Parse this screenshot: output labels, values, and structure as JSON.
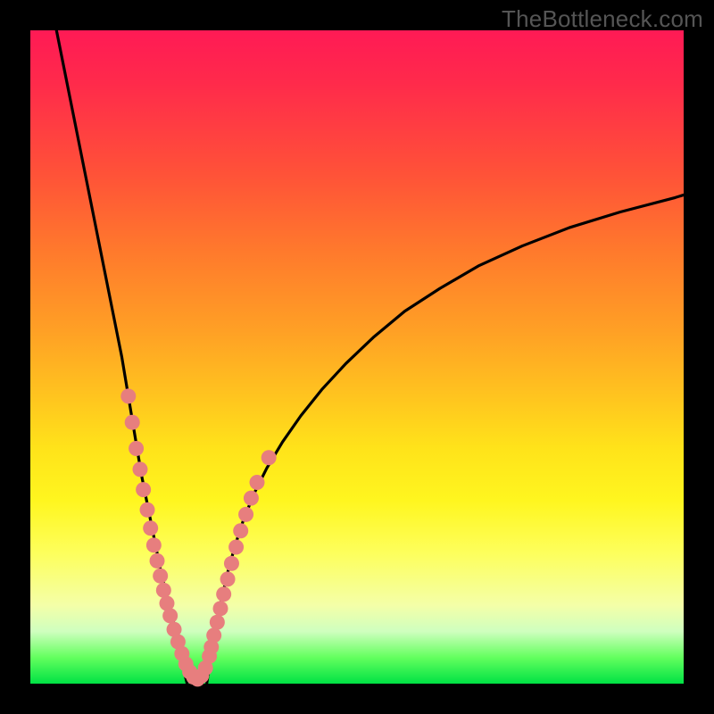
{
  "watermark": "TheBottleneck.com",
  "colors": {
    "background": "#000000",
    "curve": "#000000",
    "dot": "#e77e7e",
    "gradient_top": "#ff1a55",
    "gradient_bottom": "#00e244"
  },
  "chart_data": {
    "type": "line",
    "title": "",
    "xlabel": "",
    "ylabel": "",
    "xlim": [
      0,
      100
    ],
    "ylim": [
      0,
      100
    ],
    "note": "No axis ticks or numeric labels are drawn in the image; x/y units unknown. Values are fractional positions of the curve read off the plot.",
    "series": [
      {
        "name": "left-branch",
        "x": [
          4,
          6,
          8,
          10,
          12,
          14,
          15,
          16,
          17,
          18,
          19,
          20,
          21,
          22,
          22.5,
          23,
          23.5,
          24
        ],
        "y": [
          100,
          90,
          80,
          70,
          60,
          50,
          44,
          38,
          32,
          27,
          22,
          17,
          13,
          9,
          6,
          4,
          2,
          0
        ]
      },
      {
        "name": "right-branch",
        "x": [
          27,
          27.3,
          27.8,
          28.5,
          29.3,
          30.2,
          31.3,
          32.6,
          34.2,
          36.2,
          38.6,
          41.4,
          44.6,
          48.3,
          52.5,
          57.3,
          62.7,
          68.7,
          75.3,
          82.5,
          90.3,
          98.7,
          100
        ],
        "y": [
          0,
          2,
          5,
          9,
          13,
          17,
          21,
          25,
          29,
          33,
          37,
          41,
          45,
          49,
          53,
          57,
          60.5,
          64,
          67,
          69.8,
          72.2,
          74.4,
          74.8
        ]
      }
    ],
    "dots": {
      "name": "highlight-dots",
      "points_xy": [
        [
          15.0,
          44
        ],
        [
          15.6,
          40
        ],
        [
          16.2,
          36
        ],
        [
          16.8,
          32.8
        ],
        [
          17.3,
          29.7
        ],
        [
          17.9,
          26.6
        ],
        [
          18.4,
          23.8
        ],
        [
          18.9,
          21.2
        ],
        [
          19.4,
          18.8
        ],
        [
          19.9,
          16.5
        ],
        [
          20.4,
          14.3
        ],
        [
          20.9,
          12.3
        ],
        [
          21.4,
          10.4
        ],
        [
          22.0,
          8.3
        ],
        [
          22.6,
          6.4
        ],
        [
          23.2,
          4.6
        ],
        [
          23.8,
          3.0
        ],
        [
          24.4,
          1.8
        ],
        [
          25.0,
          1.0
        ],
        [
          25.6,
          0.7
        ],
        [
          26.2,
          1.2
        ],
        [
          26.8,
          2.4
        ],
        [
          27.4,
          4.2
        ],
        [
          27.7,
          5.6
        ],
        [
          28.1,
          7.4
        ],
        [
          28.6,
          9.4
        ],
        [
          29.1,
          11.5
        ],
        [
          29.6,
          13.7
        ],
        [
          30.2,
          16.0
        ],
        [
          30.8,
          18.4
        ],
        [
          31.5,
          20.9
        ],
        [
          32.2,
          23.4
        ],
        [
          33.0,
          25.9
        ],
        [
          33.8,
          28.4
        ],
        [
          34.7,
          30.8
        ],
        [
          36.5,
          34.6
        ]
      ]
    }
  }
}
